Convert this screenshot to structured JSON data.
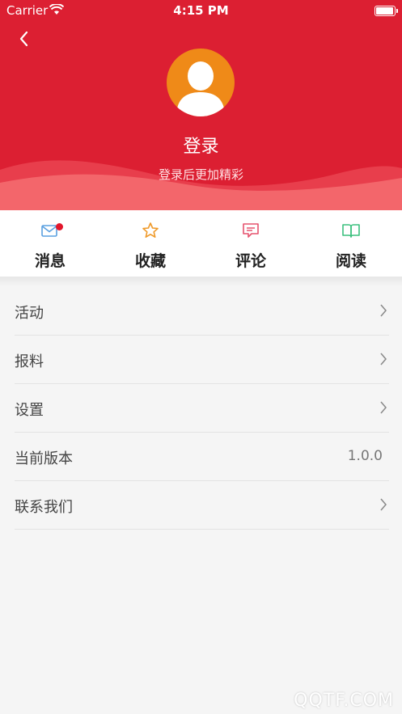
{
  "status_bar": {
    "carrier": "Carrier",
    "time": "4:15 PM"
  },
  "header": {
    "login_title": "登录",
    "login_subtitle": "登录后更加精彩",
    "colors": {
      "background": "#dc1f32",
      "avatar": "#ef8a18"
    }
  },
  "quick_actions": [
    {
      "label": "消息",
      "icon": "mail-icon",
      "color": "#5aa0e0",
      "has_badge": true
    },
    {
      "label": "收藏",
      "icon": "star-icon",
      "color": "#ef9a2a"
    },
    {
      "label": "评论",
      "icon": "comment-icon",
      "color": "#e6546f"
    },
    {
      "label": "阅读",
      "icon": "book-icon",
      "color": "#3cc07e"
    }
  ],
  "menu": [
    {
      "label": "活动"
    },
    {
      "label": "报料"
    },
    {
      "label": "设置"
    },
    {
      "label": "当前版本",
      "value": "1.0.0"
    },
    {
      "label": "联系我们"
    }
  ],
  "watermark": "QQTF.COM"
}
